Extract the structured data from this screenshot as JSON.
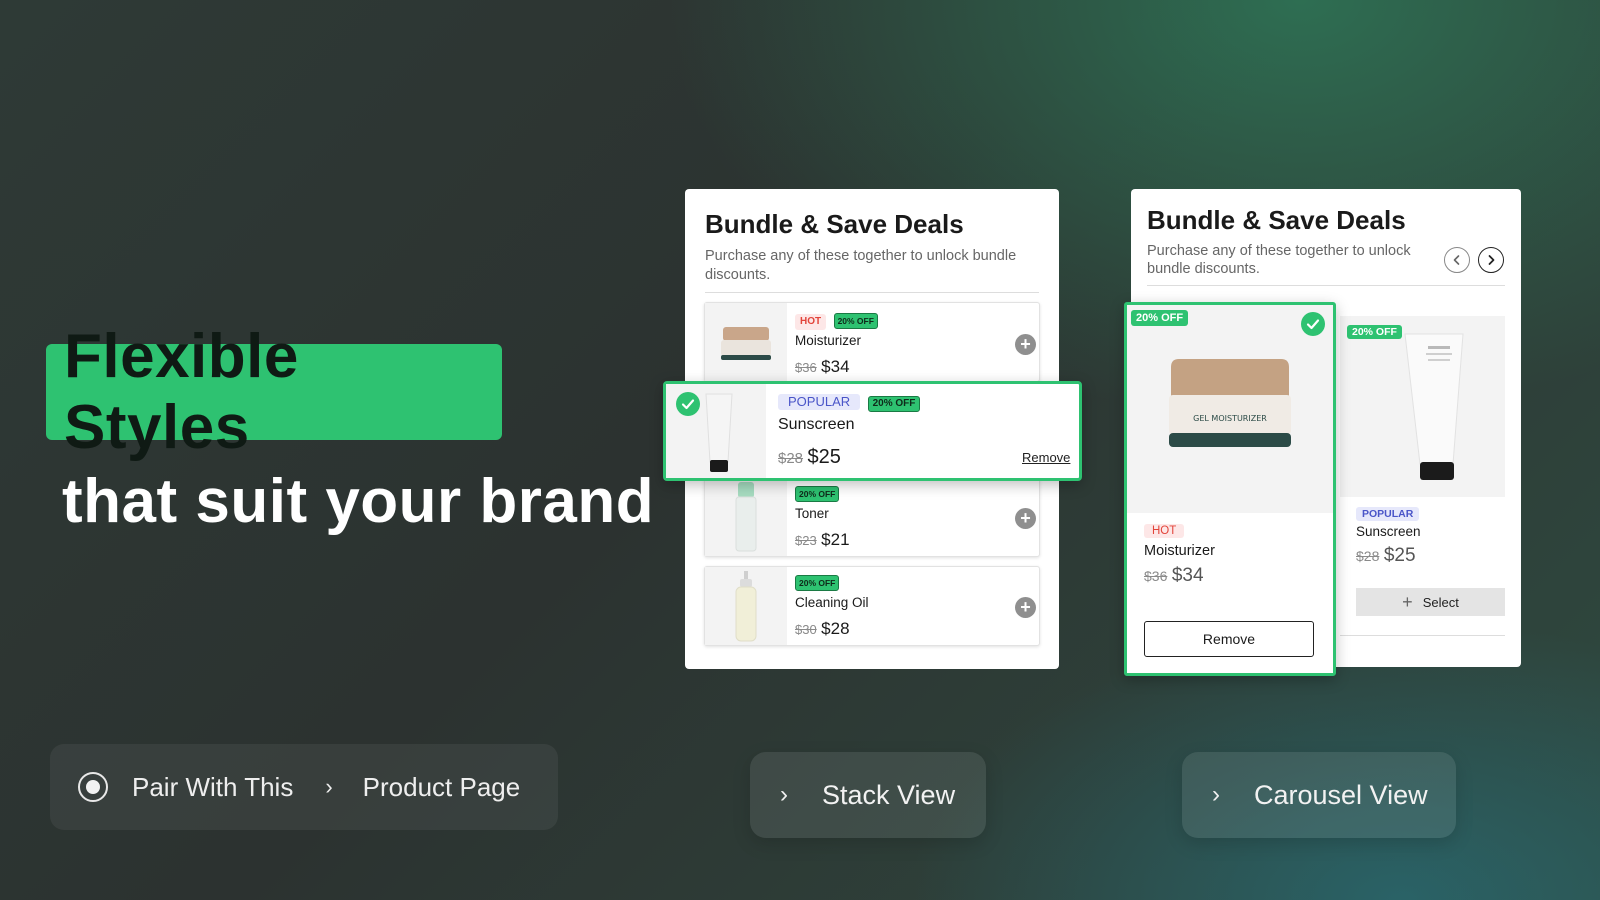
{
  "hero": {
    "title": "Flexible Styles",
    "subtitle": "that suit your brand"
  },
  "breadcrumb": {
    "item1": "Pair With This",
    "item2": "Product Page"
  },
  "view_buttons": {
    "stack": "Stack View",
    "carousel": "Carousel View"
  },
  "stack_card": {
    "title": "Bundle & Save Deals",
    "description": "Purchase any of these together to unlock bundle discounts.",
    "items": [
      {
        "tags": [
          "HOT",
          "20% OFF"
        ],
        "name": "Moisturizer",
        "old_price": "$36",
        "price": "$34"
      },
      {
        "tags": [
          "POPULAR",
          "20% OFF"
        ],
        "name": "Sunscreen",
        "old_price": "$28",
        "price": "$25",
        "action": "Remove",
        "selected": true
      },
      {
        "tags": [
          "20% OFF"
        ],
        "name": "Toner",
        "old_price": "$23",
        "price": "$21"
      },
      {
        "tags": [
          "20% OFF"
        ],
        "name": "Cleaning Oil",
        "old_price": "$30",
        "price": "$28"
      }
    ]
  },
  "carousel_card": {
    "title": "Bundle & Save Deals",
    "description_line1": "Purchase any of these together to unlock",
    "description_line2": "bundle discounts.",
    "items": [
      {
        "discount": "20% OFF",
        "product_text": "GEL MOISTURIZER",
        "tag": "HOT",
        "name": "Moisturizer",
        "old_price": "$36",
        "price": "$34",
        "action": "Remove",
        "selected": true
      },
      {
        "discount": "20% OFF",
        "tag": "POPULAR",
        "name": "Sunscreen",
        "old_price": "$28",
        "price": "$25",
        "action": "Select"
      }
    ]
  },
  "colors": {
    "accent": "#2ec271",
    "hot": "#e2443a",
    "popular": "#4a55c8"
  }
}
